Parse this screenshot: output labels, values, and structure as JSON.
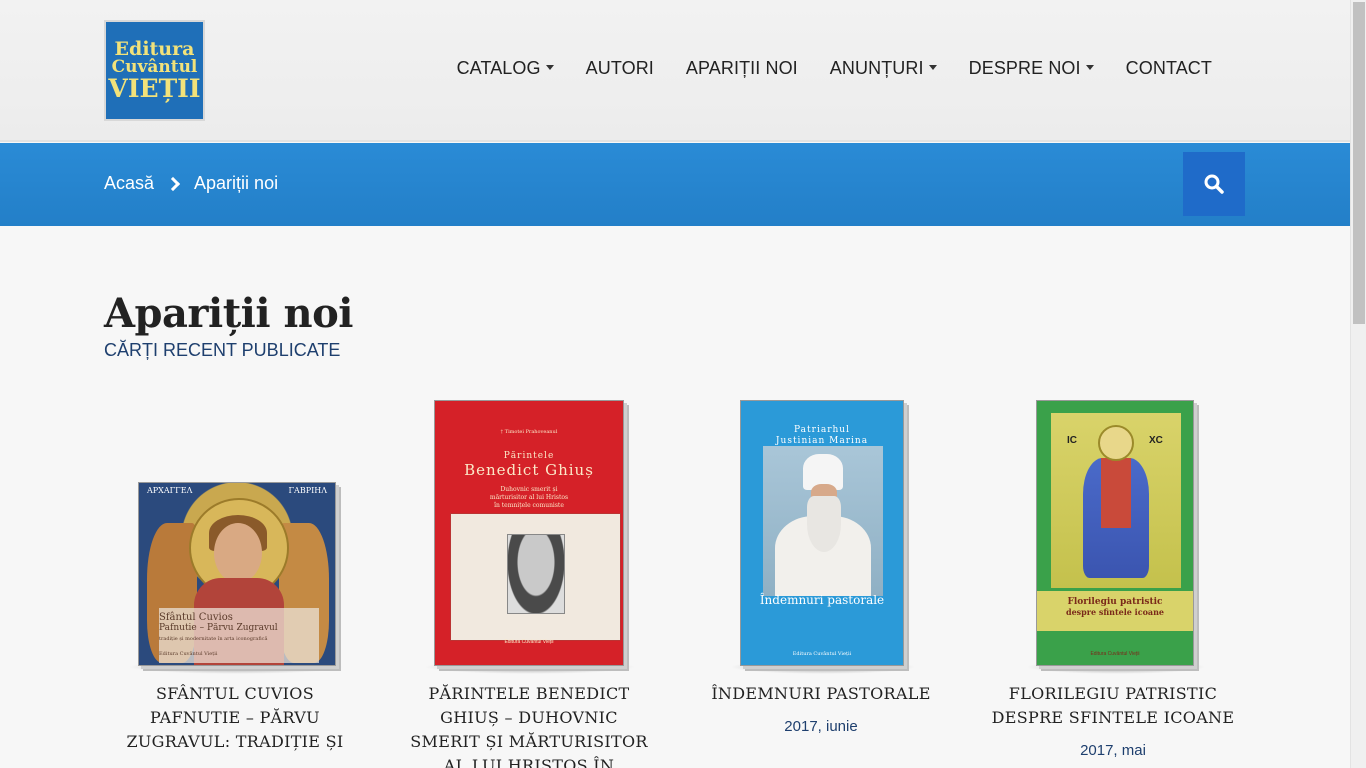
{
  "brand": {
    "logo_line1": "Editura",
    "logo_line2": "Cuvântul",
    "logo_line3": "VIEȚII",
    "logo_bg": "#1f6fb8",
    "logo_text_color": "#f2e27a"
  },
  "nav": {
    "items": [
      {
        "label": "CATALOG",
        "dropdown": true
      },
      {
        "label": "AUTORI",
        "dropdown": false
      },
      {
        "label": "APARIȚII NOI",
        "dropdown": false
      },
      {
        "label": "ANUNȚURI",
        "dropdown": true
      },
      {
        "label": "DESPRE NOI",
        "dropdown": true
      },
      {
        "label": "CONTACT",
        "dropdown": false
      }
    ]
  },
  "breadcrumb": {
    "home": "Acasă",
    "current": "Apariții noi",
    "bar_color": "#2385d0"
  },
  "search": {
    "icon": "search-icon"
  },
  "main": {
    "title": "Apariții noi",
    "subtitle": "CĂRȚI RECENT PUBLICATE"
  },
  "books": [
    {
      "title_lines": [
        "SFÂNTUL CUVIOS",
        "PAFNUTIE – PĂRVU",
        "ZUGRAVUL: TRADIȚIE ȘI"
      ],
      "date": "",
      "cover": {
        "top_left": "ΑΡΧΑΓΓΕΛ",
        "top_right": "ΓΑΒΡΙΗΛ",
        "line1": "Sfântul Cuvios",
        "line2": "Pafnutie – Părvu Zugravul",
        "line3": "tradiție și modernitate în arta iconografică",
        "line4": "Editura Cuvântul Vieții"
      }
    },
    {
      "title_lines": [
        "PĂRINTELE BENEDICT",
        "GHIUȘ – DUHOVNIC",
        "SMERIT ȘI MĂRTURISITOR",
        "AL LUI HRISTOS ÎN"
      ],
      "date": "",
      "cover": {
        "author": "† Timotei Prahoveanul",
        "line0": "Părintele",
        "name": "Benedict Ghiuș",
        "sub1": "Duhovnic smerit și",
        "sub2": "mărturisitor al lui Hristos",
        "sub3": "în temnițele comuniste",
        "publisher": "Editura Cuvântul Vieții"
      }
    },
    {
      "title_lines": [
        "ÎNDEMNURI PASTORALE"
      ],
      "date": "2017, iunie",
      "cover": {
        "top1": "Patriarhul",
        "top2": "Justinian Marina",
        "bottom": "Îndemnuri pastorale",
        "publisher": "Editura Cuvântul Vieții"
      }
    },
    {
      "title_lines": [
        "FLORILEGIU PATRISTIC",
        "DESPRE SFINTELE ICOANE"
      ],
      "date": "2017, mai",
      "cover": {
        "ic": "IC",
        "xc": "XC",
        "band1": "Florilegiu patristic",
        "band2": "despre sfintele icoane",
        "publisher": "Editura Cuvântul Vieții"
      }
    }
  ]
}
